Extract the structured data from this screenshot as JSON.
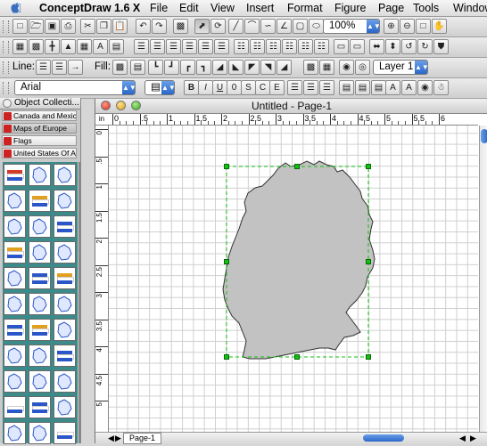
{
  "menubar": {
    "app_title": "ConceptDraw 1.6 X",
    "items": [
      "File",
      "Edit",
      "View",
      "Insert",
      "Format",
      "Figure",
      "Page",
      "Tools",
      "Window"
    ]
  },
  "toolbar": {
    "zoom_value": "100%",
    "line_label": "Line:",
    "fill_label": "Fill:",
    "layer_value": "Layer 1",
    "font_value": "Arial",
    "bold_label": "B",
    "italic_label": "I",
    "underline_label": "U",
    "outline_label": "0",
    "shadow_label": "S",
    "caps_label": "C",
    "case_label": "E",
    "text_label": "A"
  },
  "object_collection": {
    "title": "Object Collecti...",
    "items": [
      "Canada and Mexico",
      "Maps of Europe",
      "Flags",
      "United States Of Am..."
    ],
    "selected_index": 1
  },
  "document": {
    "title": "Untitled - Page-1",
    "ruler_unit": "in",
    "h_ruler_labels": [
      "0",
      ".5",
      "1",
      "1.5",
      "2",
      "2.5",
      "3",
      "3.5",
      "4",
      "4.5",
      "5",
      "5.5",
      "6"
    ],
    "v_ruler_labels": [
      "0",
      ".5",
      "1",
      "1.5",
      "2",
      "2.5",
      "3",
      "3.5",
      "4",
      "4.5",
      "5"
    ],
    "page_tab": "Page-1",
    "shape_name": "germany-map-shape"
  },
  "colors": {
    "selection_handle": "#11c011",
    "shape_fill": "#c2c2c2",
    "panel_bg": "#3d8a8a",
    "accent_blue": "#2a66c7"
  }
}
